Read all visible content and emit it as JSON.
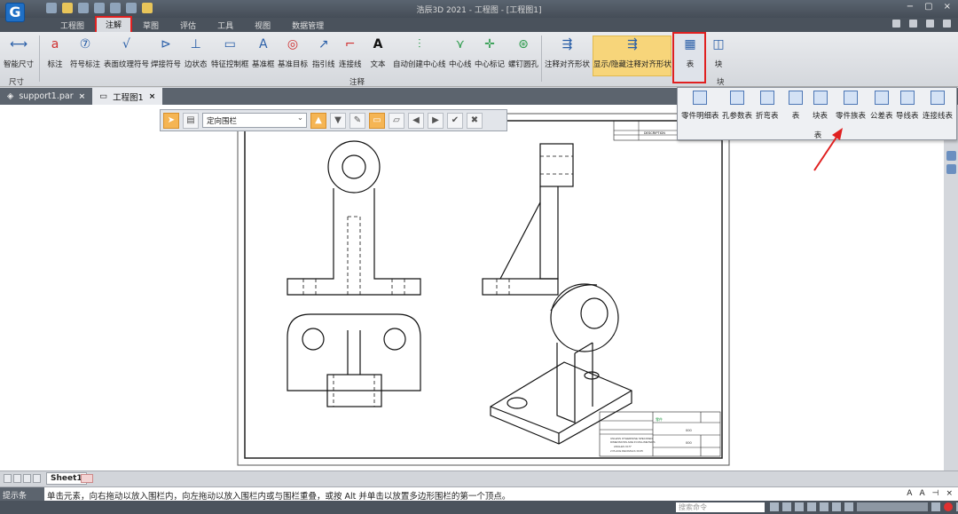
{
  "app": {
    "logo_letter": "G",
    "title": "浩辰3D 2021 - 工程图 - [工程图1]",
    "accent_color": "#f5b554",
    "highlight_color": "#e02020"
  },
  "window_controls": [
    "−",
    "▢",
    "×"
  ],
  "ribbon_tabs": [
    "工程图",
    "注解",
    "草图",
    "评估",
    "工具",
    "视图",
    "数据管理"
  ],
  "ribbon_buttons": [
    {
      "label": "智能尺寸",
      "icon": "smart-dimension-icon",
      "glyph": "⟷"
    },
    {
      "label": "标注",
      "icon": "callout-icon",
      "glyph": "a"
    },
    {
      "label": "符号标注",
      "icon": "balloon-icon",
      "glyph": "⑦"
    },
    {
      "label": "表面纹理符号",
      "icon": "surface-texture-icon",
      "glyph": "√"
    },
    {
      "label": "焊接符号",
      "icon": "weld-symbol-icon",
      "glyph": "⊳"
    },
    {
      "label": "边状态",
      "icon": "edge-condition-icon",
      "glyph": "⊥"
    },
    {
      "label": "特征控制框",
      "icon": "feature-control-frame-icon",
      "glyph": "▭"
    },
    {
      "label": "基准框",
      "icon": "datum-frame-icon",
      "glyph": "A"
    },
    {
      "label": "基准目标",
      "icon": "datum-target-icon",
      "glyph": "◎"
    },
    {
      "label": "指引线",
      "icon": "leader-icon",
      "glyph": "↗"
    },
    {
      "label": "连接线",
      "icon": "connector-icon",
      "glyph": "⌐"
    },
    {
      "label": "文本",
      "icon": "text-icon",
      "glyph": "A"
    },
    {
      "label": "自动创建中心线",
      "icon": "auto-centerline-icon",
      "glyph": "⫶"
    },
    {
      "label": "中心线",
      "icon": "centerline-icon",
      "glyph": "⋎"
    },
    {
      "label": "中心标记",
      "icon": "center-mark-icon",
      "glyph": "✛"
    },
    {
      "label": "螺钉圆孔",
      "icon": "bolt-hole-circle-icon",
      "glyph": "⊛"
    },
    {
      "label": "注释对齐形状",
      "icon": "align-shape-icon",
      "glyph": "⇶"
    },
    {
      "label": "显示/隐藏注释对齐形状",
      "icon": "show-hide-align-icon",
      "glyph": "⇶"
    },
    {
      "label": "表",
      "icon": "table-icon",
      "glyph": "▦"
    },
    {
      "label": "块",
      "icon": "block-icon",
      "glyph": "◫"
    }
  ],
  "ribbon_groups": {
    "dimension": "尺寸",
    "annotation": "注释",
    "block_small": "块"
  },
  "doc_tabs": [
    {
      "label": "support1.par",
      "active": false
    },
    {
      "label": "工程图1",
      "active": true
    }
  ],
  "float_toolbar": {
    "fence_dropdown": "定向围栏"
  },
  "table_menu": {
    "items": [
      "零件明细表",
      "孔参数表",
      "折弯表",
      "表",
      "块表",
      "零件族表",
      "公差表",
      "导线表",
      "连接线表"
    ],
    "caption": "表"
  },
  "sheet_tab": "Sheet1",
  "prompt": {
    "label": "提示条",
    "text": "单击元素，向右拖动以放入围栏内，向左拖动以放入围栏内或与围栏重叠，或按 Alt 并单击以放置多边形围栏的第一个顶点。"
  },
  "command_search_placeholder": "搜索命令",
  "title_block": {
    "part_number": "零件",
    "field_value": "000",
    "notes": [
      "UNLESS OTHERWISE SPECIFIED",
      "DIMENSIONS ARE IN MILLIMETERS",
      "ANGLES ±0.5°",
      "2 PLACE DECIMALS ±0.05"
    ],
    "header": "DESCRIPTION"
  }
}
